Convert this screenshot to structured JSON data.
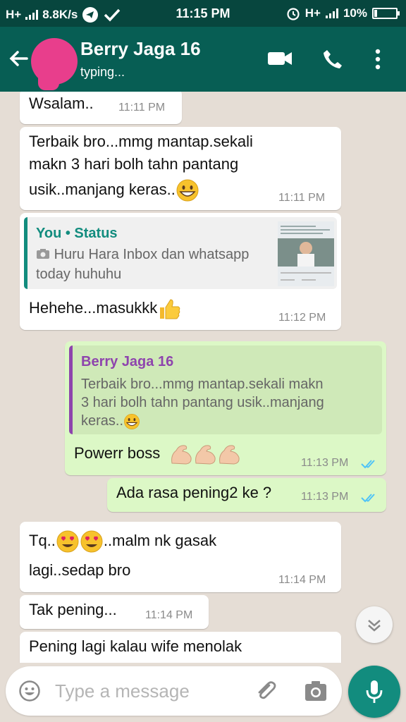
{
  "status_bar": {
    "net_left": "H+",
    "speed": "8.8K/s",
    "time": "11:15 PM",
    "net_right": "H+",
    "battery": "10%"
  },
  "header": {
    "contact_name": "Berry Jaga 16",
    "status": "typing..."
  },
  "messages": [
    {
      "dir": "in",
      "lines": [
        "Wsalam.."
      ],
      "time": "11:11 PM"
    },
    {
      "dir": "in",
      "lines": [
        "Terbaik bro...mmg mantap.sekali",
        "makn 3 hari bolh tahn pantang",
        "usik..manjang keras.."
      ],
      "time": "11:11 PM",
      "emoji": "grin"
    },
    {
      "dir": "in",
      "quote": {
        "author": "You • Status",
        "text": "Huru Hara Inbox dan whatsapp",
        "text2": "today huhuhu"
      },
      "lines": [
        "Hehehe...masukkk"
      ],
      "time": "11:12 PM",
      "emoji": "thumbs-up"
    },
    {
      "dir": "out",
      "quote": {
        "author": "Berry Jaga 16",
        "text": "Terbaik bro...mmg mantap.sekali makn",
        "text2": "3 hari bolh tahn pantang usik..manjang",
        "text3": "keras.."
      },
      "lines": [
        "Powerr boss"
      ],
      "time": "11:13 PM",
      "emoji": "flexed-biceps"
    },
    {
      "dir": "out",
      "lines": [
        "Ada rasa pening2 ke ?"
      ],
      "time": "11:13 PM"
    },
    {
      "dir": "in",
      "lines": [
        "Tq..",
        "..malm nk gasak",
        "lagi..sedap bro"
      ],
      "time": "11:14 PM",
      "emoji": "heart-eyes"
    },
    {
      "dir": "in",
      "lines": [
        "Tak pening..."
      ],
      "time": "11:14 PM"
    },
    {
      "dir": "in",
      "lines": [
        "Pening lagi kalau wife menolak"
      ]
    }
  ],
  "input": {
    "placeholder": "Type a message"
  },
  "colors": {
    "header": "#075e54",
    "status_bar": "#07463e",
    "outgoing_bubble": "#dcf8c6",
    "incoming_bubble": "#ffffff",
    "read_ticks": "#4fc3f7",
    "quote_you": "#128c7e",
    "quote_contact": "#8e44ad",
    "mic_button": "#128c7e",
    "avatar_redaction": "#e83e8c"
  },
  "icons": [
    "signal-icon",
    "telegram-icon",
    "check-icon",
    "alarm-icon",
    "battery-icon",
    "back-arrow-icon",
    "video-call-icon",
    "phone-icon",
    "more-vert-icon",
    "camera-icon",
    "double-check-icon",
    "chevron-down-icon",
    "emoji-icon",
    "attach-icon",
    "mic-icon"
  ]
}
